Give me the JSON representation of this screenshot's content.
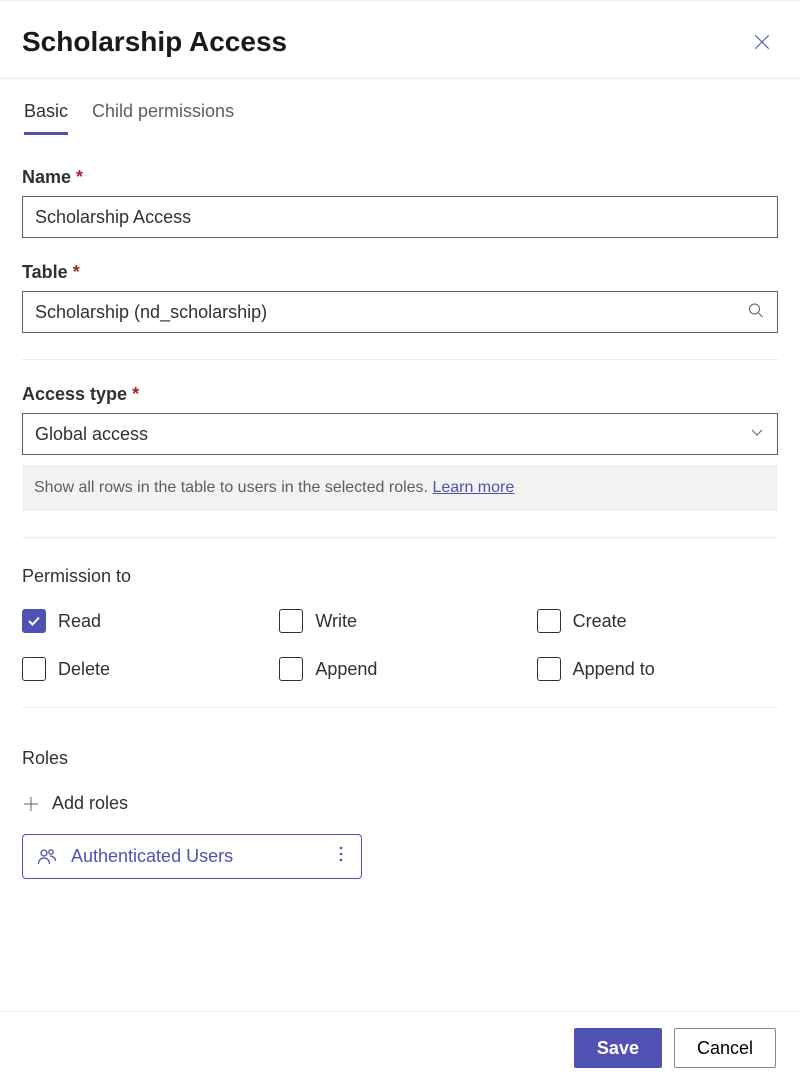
{
  "header": {
    "title": "Scholarship Access"
  },
  "tabs": {
    "basic": "Basic",
    "child_permissions": "Child permissions"
  },
  "fields": {
    "name": {
      "label": "Name",
      "value": "Scholarship Access"
    },
    "table": {
      "label": "Table",
      "value": "Scholarship (nd_scholarship)"
    },
    "access_type": {
      "label": "Access type",
      "value": "Global access",
      "info_text": "Show all rows in the table to users in the selected roles. ",
      "info_link": "Learn more"
    }
  },
  "permissions": {
    "section_label": "Permission to",
    "items": {
      "read": {
        "label": "Read",
        "checked": true
      },
      "write": {
        "label": "Write",
        "checked": false
      },
      "create": {
        "label": "Create",
        "checked": false
      },
      "delete": {
        "label": "Delete",
        "checked": false
      },
      "append": {
        "label": "Append",
        "checked": false
      },
      "append_to": {
        "label": "Append to",
        "checked": false
      }
    }
  },
  "roles": {
    "section_label": "Roles",
    "add_label": "Add roles",
    "items": [
      {
        "name": "Authenticated Users"
      }
    ]
  },
  "footer": {
    "save": "Save",
    "cancel": "Cancel"
  }
}
